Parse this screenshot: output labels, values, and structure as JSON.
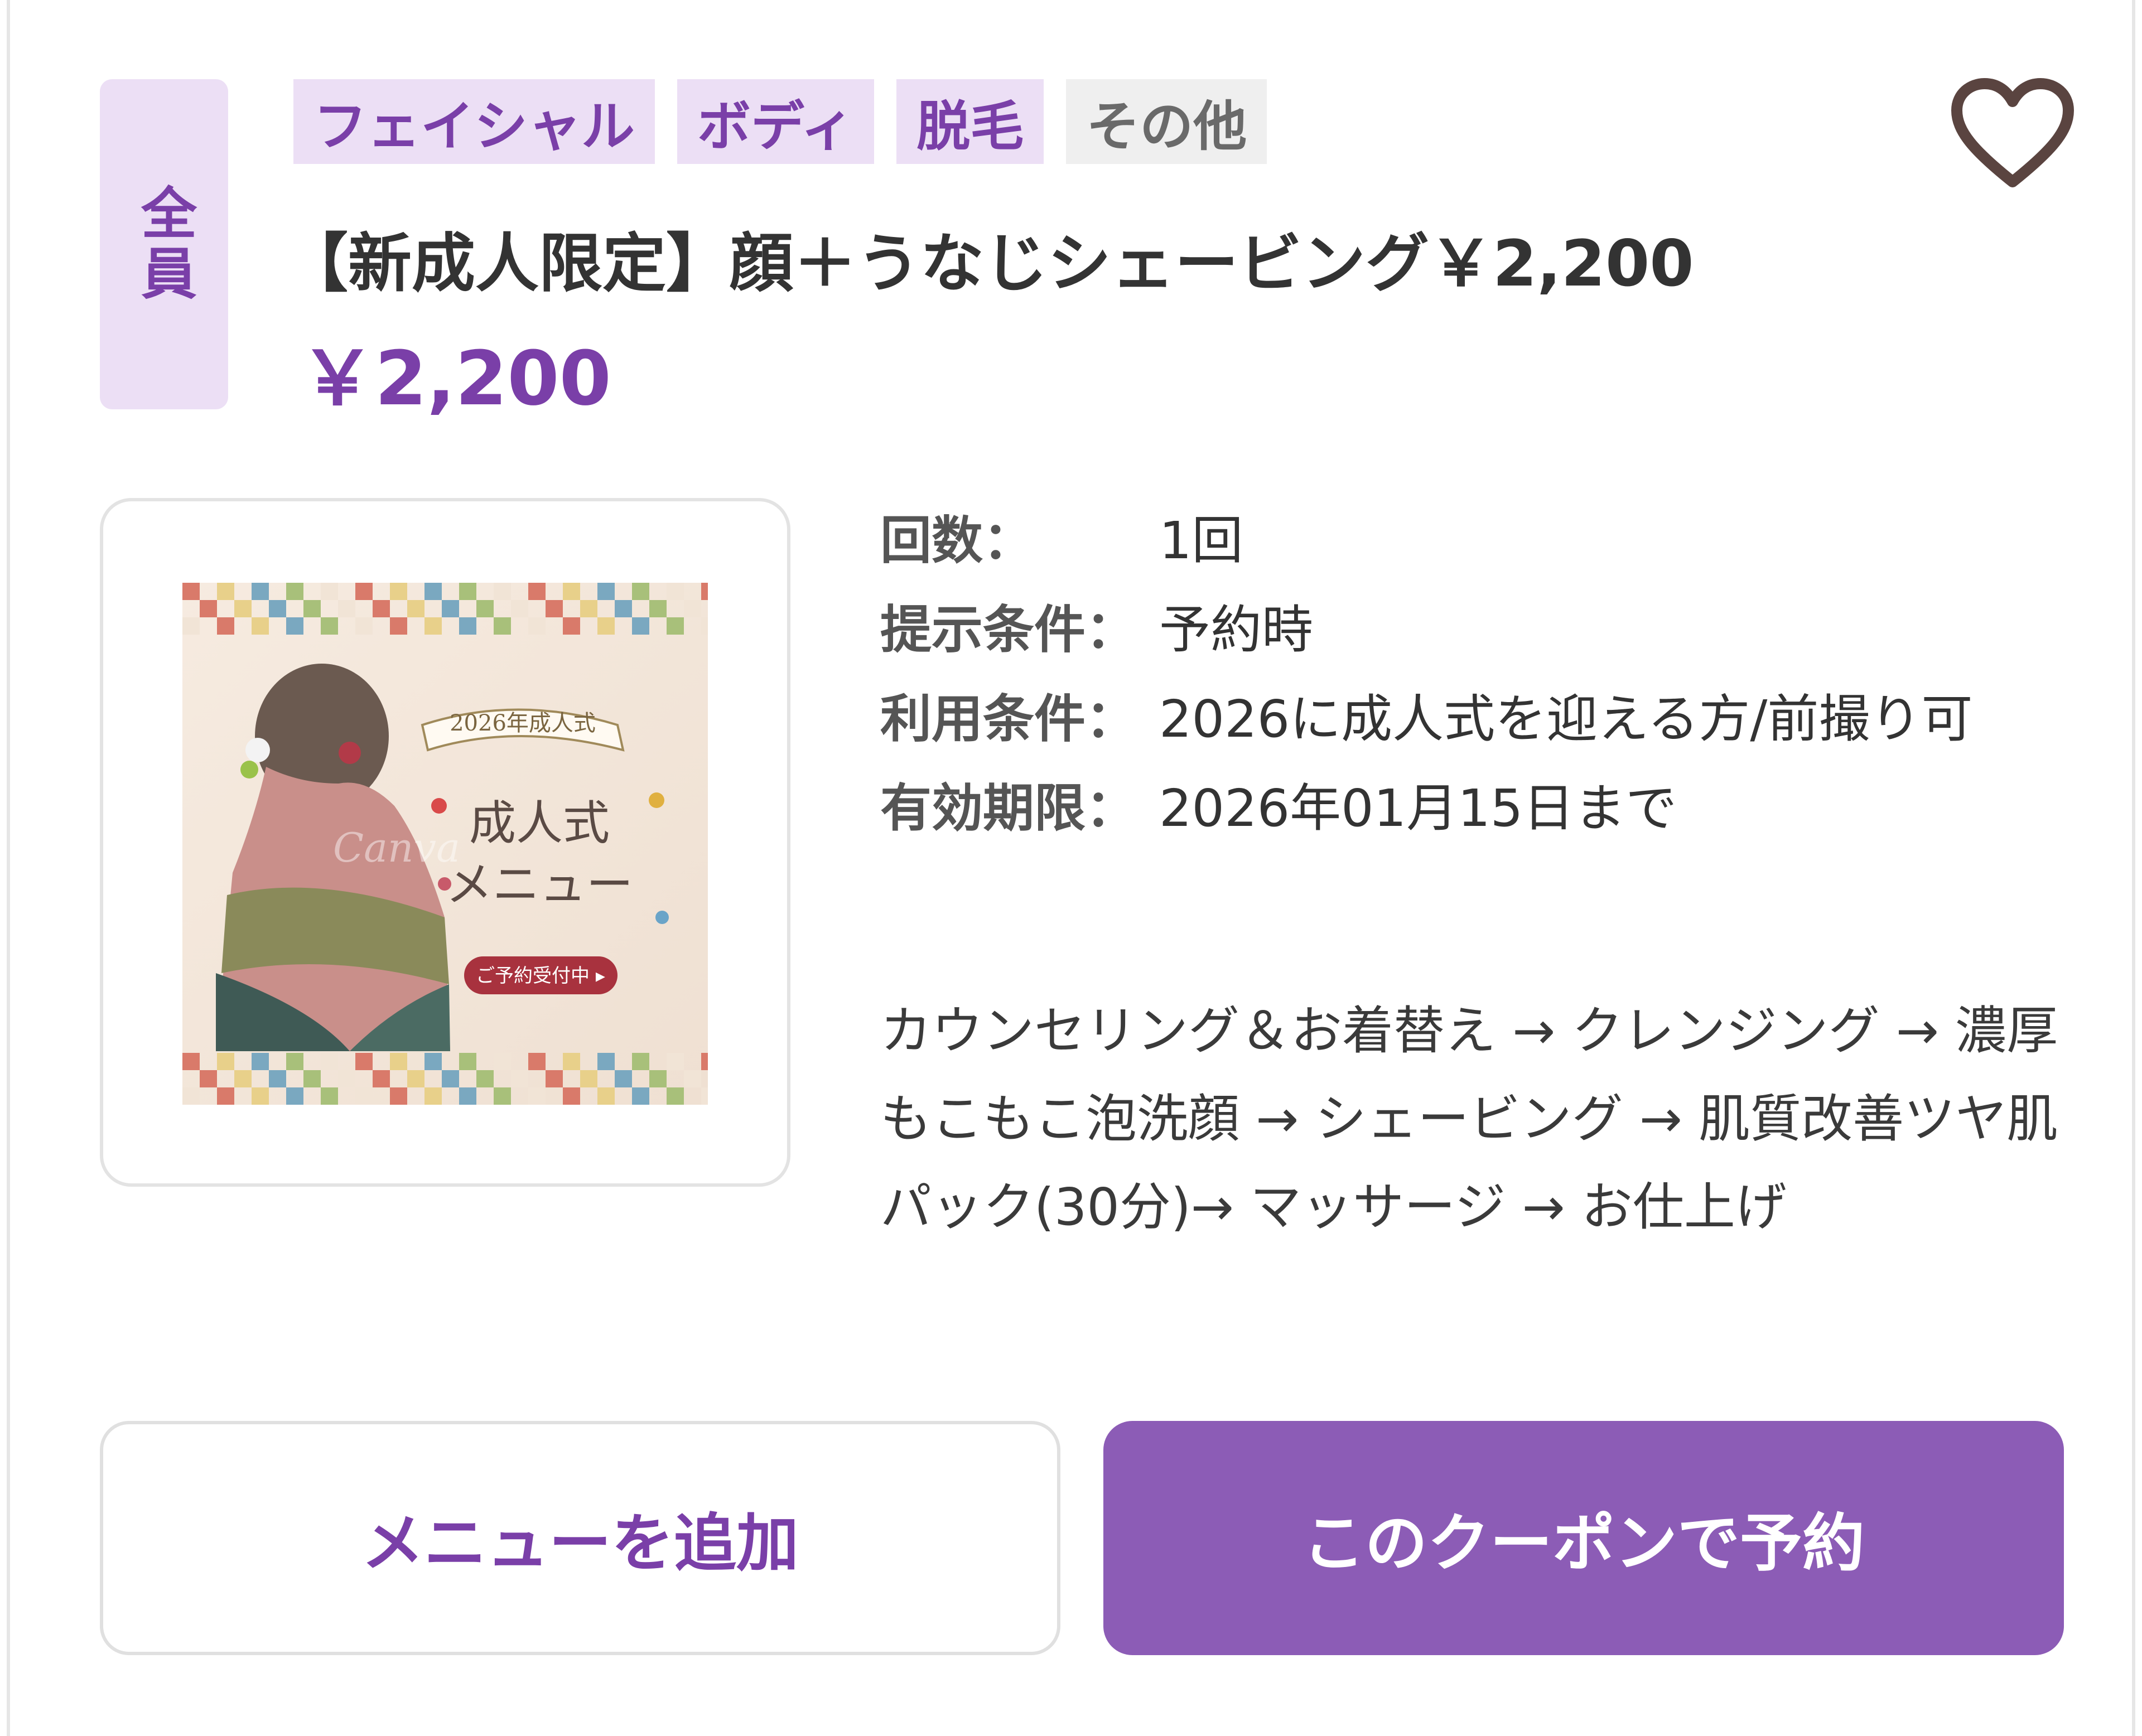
{
  "badge": {
    "target": "全員"
  },
  "tags": [
    {
      "label": "フェイシャル",
      "kind": "active"
    },
    {
      "label": "ボディ",
      "kind": "active"
    },
    {
      "label": "脱毛",
      "kind": "active"
    },
    {
      "label": "その他",
      "kind": "inactive"
    }
  ],
  "favorite": {
    "icon": "heart-outline-icon"
  },
  "coupon": {
    "title": "【新成人限定】顔＋うなじシェービング￥2,200",
    "price": "￥2,200"
  },
  "image": {
    "subject": "coming-of-age-kimono-banner",
    "ribbon_text": "2026年成人式",
    "heading_line1": "成人式",
    "heading_line2": "メニュー",
    "cta_text": "ご予約受付中 ▸",
    "watermark": "Canva"
  },
  "details": [
    {
      "key": "回数：",
      "value": "1回"
    },
    {
      "key": "提示条件：",
      "value": "予約時"
    },
    {
      "key": "利用条件：",
      "value": "2026に成人式を迎える方/前撮り可"
    },
    {
      "key": "有効期限：",
      "value": "2026年01月15日まで"
    }
  ],
  "description": "カウンセリング＆お着替え → クレンジング → 濃厚もこもこ泡洗顔 → シェービング → 肌質改善ツヤ肌パック(30分)→ マッサージ → お仕上げ",
  "actions": {
    "add_menu": "メニューを追加",
    "book_with_coupon": "このクーポンで予約"
  },
  "colors": {
    "accent": "#7a3fa8",
    "tag_bg": "#ecdff5",
    "button_primary": "#8c5cb6",
    "heart": "#5a4440"
  }
}
